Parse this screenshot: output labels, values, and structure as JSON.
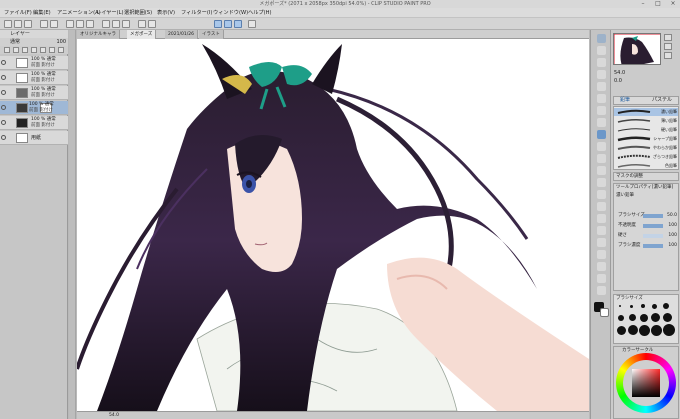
{
  "app": {
    "window_title": "メガポーズ* (2071 x 2058px 350dpi 54.0%) - CLIP STUDIO PAINT PRO"
  },
  "menu": [
    "ファイル(F)",
    "編集(E)",
    "アニメーション(A)",
    "レイヤー(L)",
    "選択範囲(S)",
    "表示(V)",
    "フィルター(I)",
    "ウィンドウ(W)",
    "ヘルプ(H)"
  ],
  "layer_panel": {
    "header": "レイヤー",
    "blend_mode": "通常",
    "opacity": "100",
    "layers": [
      {
        "line1": "100 % 通常",
        "line2": "前面 影付け"
      },
      {
        "line1": "100 % 通常",
        "line2": "前面 影付け"
      },
      {
        "line1": "100 % 通常",
        "line2": "前面 影付け"
      },
      {
        "line1": "100 % 通常",
        "line2": "前面 影付け"
      },
      {
        "line1": "100 % 通常",
        "line2": "前面 影付け"
      },
      {
        "name": "用紙"
      }
    ]
  },
  "tabs": [
    "オリジナルキャラ",
    "メガポーズ",
    "2021/01/26",
    "イラスト"
  ],
  "status": {
    "zoom": "54.0"
  },
  "navigator": {
    "zoom": "54.0",
    "angle": "0.0"
  },
  "brush_panel": {
    "tab1": "鉛筆",
    "tab2": "パステル",
    "brushes": [
      "濃い鉛筆",
      "薄い鉛筆",
      "硬い鉛筆",
      "シャープ鉛筆",
      "やわらか鉛筆",
      "ざらつき鉛筆",
      "色鉛筆"
    ]
  },
  "tool_property": {
    "header": "マスクの調整",
    "sub_header": "ツールプロパティ[濃い鉛筆]",
    "tool_name": "濃い鉛筆",
    "props": [
      {
        "label": "ブラシサイズ",
        "value": "50.0"
      },
      {
        "label": "不透明度",
        "value": "100"
      },
      {
        "label": "硬さ",
        "value": "100"
      },
      {
        "label": "ブラシ濃度",
        "value": "100"
      }
    ]
  },
  "brush_size_panel": {
    "header": "ブラシサイズ",
    "sizes": [
      "1",
      "1.5",
      "2",
      "2.5",
      "3",
      "4",
      "5",
      "6",
      "7",
      "8",
      "10",
      "12",
      "15",
      "17",
      "20",
      "25",
      "30",
      "40"
    ]
  },
  "color_panel": {
    "header": "カラーサークル",
    "footer": "■ 0 0 0   H 0 S 0 V 0"
  },
  "colors": {
    "hair_dark": "#1b1320",
    "hair_purple": "#4a2f5a",
    "ribbon_teal": "#1e9e88",
    "ribbon_gold": "#d4b84a",
    "skin": "#f6dcd3",
    "eye_blue": "#3b53a8",
    "selection_blue": "#9fb8d6"
  }
}
